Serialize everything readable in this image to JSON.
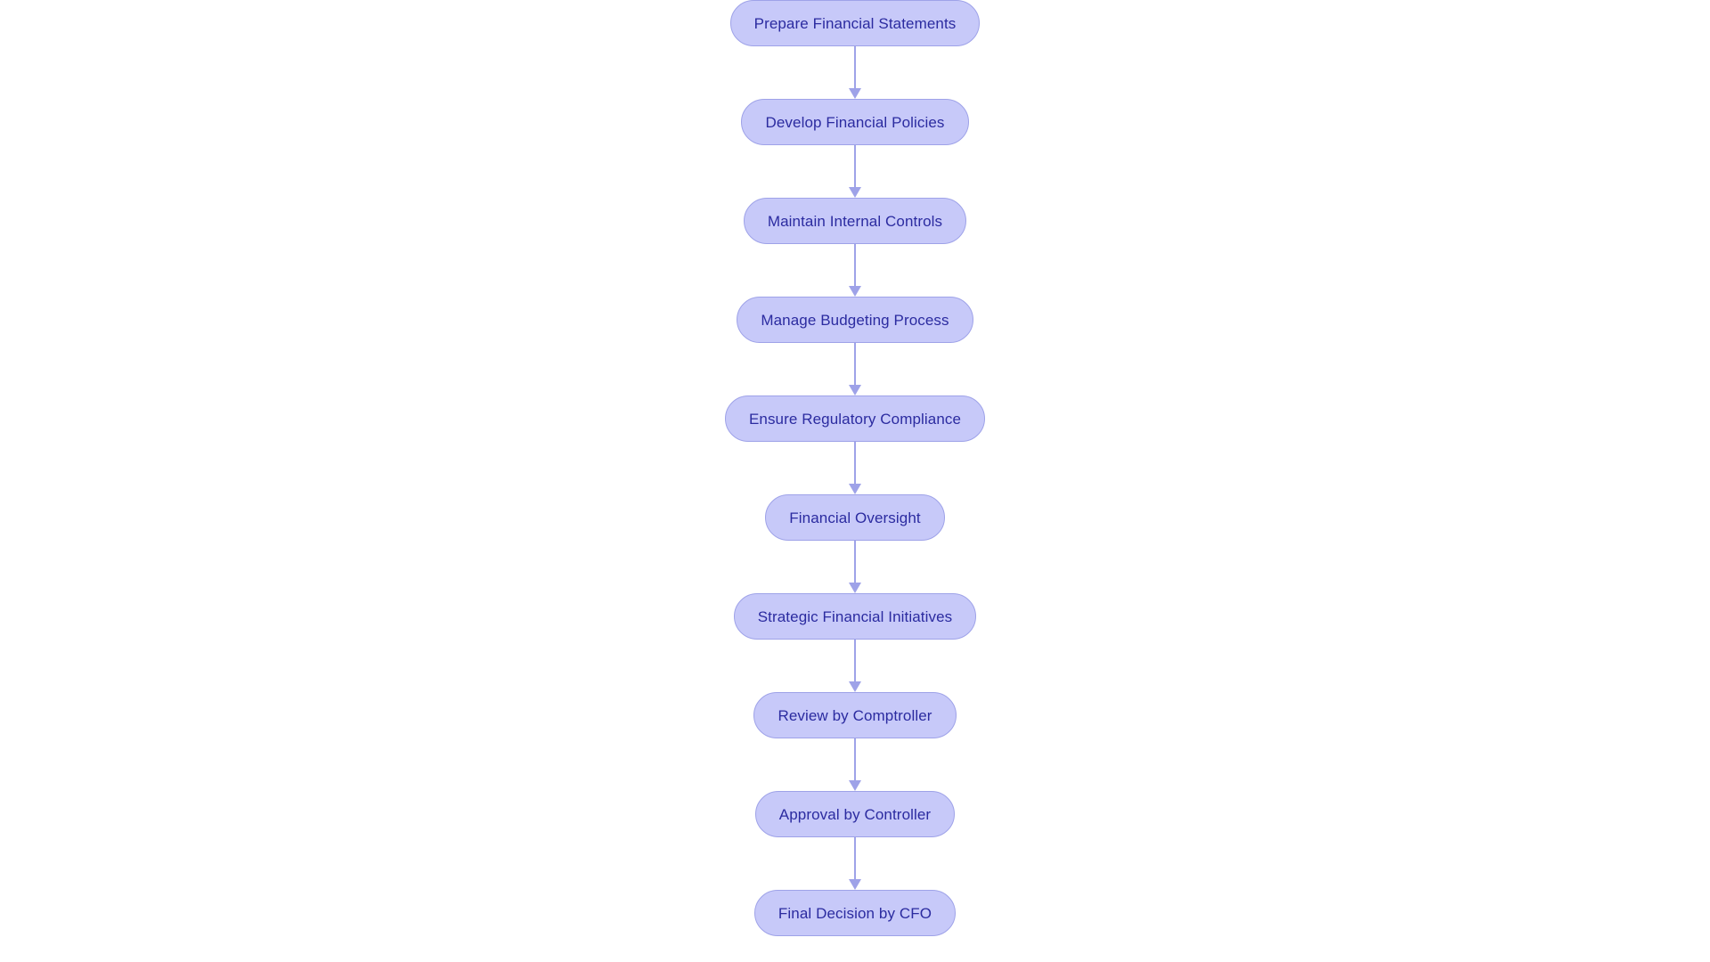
{
  "diagram": {
    "type": "flowchart",
    "orientation": "vertical-top-to-bottom",
    "title": "",
    "background_color": "#ffffff",
    "node_fill_color": "#c7c9f9",
    "node_border_color": "#9ea2e8",
    "node_text_color": "#2b2ba0",
    "connector_color": "#9ea2e8",
    "node_shape": "rounded-pill",
    "nodes": [
      {
        "id": "n1",
        "label": "Prepare Financial Statements"
      },
      {
        "id": "n2",
        "label": "Develop Financial Policies"
      },
      {
        "id": "n3",
        "label": "Maintain Internal Controls"
      },
      {
        "id": "n4",
        "label": "Manage Budgeting Process"
      },
      {
        "id": "n5",
        "label": "Ensure Regulatory Compliance"
      },
      {
        "id": "n6",
        "label": "Financial Oversight"
      },
      {
        "id": "n7",
        "label": "Strategic Financial Initiatives"
      },
      {
        "id": "n8",
        "label": "Review by Comptroller"
      },
      {
        "id": "n9",
        "label": "Approval by Controller"
      },
      {
        "id": "n10",
        "label": "Final Decision by CFO"
      }
    ],
    "edges": [
      {
        "from": "n1",
        "to": "n2",
        "label": "",
        "arrow": "down"
      },
      {
        "from": "n2",
        "to": "n3",
        "label": "",
        "arrow": "down"
      },
      {
        "from": "n3",
        "to": "n4",
        "label": "",
        "arrow": "down"
      },
      {
        "from": "n4",
        "to": "n5",
        "label": "",
        "arrow": "down"
      },
      {
        "from": "n5",
        "to": "n6",
        "label": "",
        "arrow": "down"
      },
      {
        "from": "n6",
        "to": "n7",
        "label": "",
        "arrow": "down"
      },
      {
        "from": "n7",
        "to": "n8",
        "label": "",
        "arrow": "down"
      },
      {
        "from": "n8",
        "to": "n9",
        "label": "",
        "arrow": "down"
      },
      {
        "from": "n9",
        "to": "n10",
        "label": "",
        "arrow": "down"
      }
    ]
  }
}
